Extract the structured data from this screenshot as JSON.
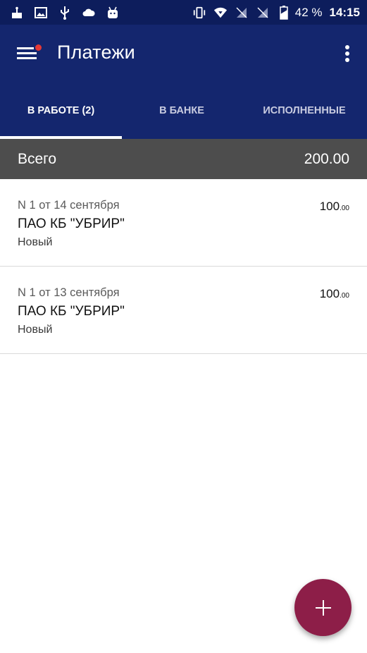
{
  "status_bar": {
    "left_icons": [
      "cake-icon",
      "image-icon",
      "usb-icon",
      "cloud-icon",
      "android-icon"
    ],
    "right_icons": [
      "vibrate-icon",
      "wifi-icon",
      "no-sim-icon",
      "no-sim-icon",
      "battery-icon"
    ],
    "battery": "42 %",
    "time": "14:15"
  },
  "app_bar": {
    "title": "Платежи",
    "menu_icon": "hamburger-icon",
    "more_icon": "more-vert-icon"
  },
  "tabs": [
    {
      "label": "В РАБОТЕ (2)",
      "active": true
    },
    {
      "label": "В БАНКЕ",
      "active": false
    },
    {
      "label": "ИСПОЛНЕННЫЕ",
      "active": false
    }
  ],
  "total": {
    "label": "Всего",
    "value": "200.00"
  },
  "payments": [
    {
      "meta": "N 1 от 14 сентября",
      "name": "ПАО КБ \"УБРИР\"",
      "status": "Новый",
      "amount_main": "100",
      "amount_cents": ".00"
    },
    {
      "meta": "N 1 от 13 сентября",
      "name": "ПАО КБ \"УБРИР\"",
      "status": "Новый",
      "amount_main": "100",
      "amount_cents": ".00"
    }
  ],
  "fab": {
    "icon": "plus-icon"
  },
  "colors": {
    "status_bar": "#0d1d5c",
    "app_bar": "#14266e",
    "total_bar": "#4d4d4d",
    "fab": "#8d1e48",
    "notification_dot": "#e53935"
  }
}
